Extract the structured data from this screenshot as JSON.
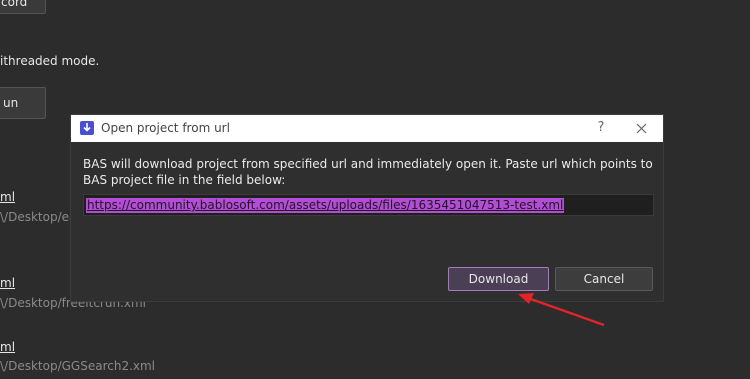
{
  "background": {
    "top_button_label": "cord",
    "multithread_text": "ithreaded mode.",
    "run_button_label": "un",
    "files": [
      {
        "name": "ml",
        "path": "\\/Desktop/ea"
      },
      {
        "name": "ml",
        "path": "\\/Desktop/freeitcrun.xml"
      },
      {
        "name": "ml",
        "path": "\\/Desktop/GGSearch2.xml"
      }
    ]
  },
  "dialog": {
    "title": "Open project from url",
    "help_label": "?",
    "description": "BAS will download project from specified url and immediately open it. Paste url which points to BAS project file in the field below:",
    "url_value": "https://community.bablosoft.com/assets/uploads/files/1635451047513-test.xml",
    "download_label": "Download",
    "cancel_label": "Cancel"
  },
  "colors": {
    "accent": "#b44cd8",
    "arrow": "#e0242a",
    "title_icon": "#4a4fcf"
  }
}
